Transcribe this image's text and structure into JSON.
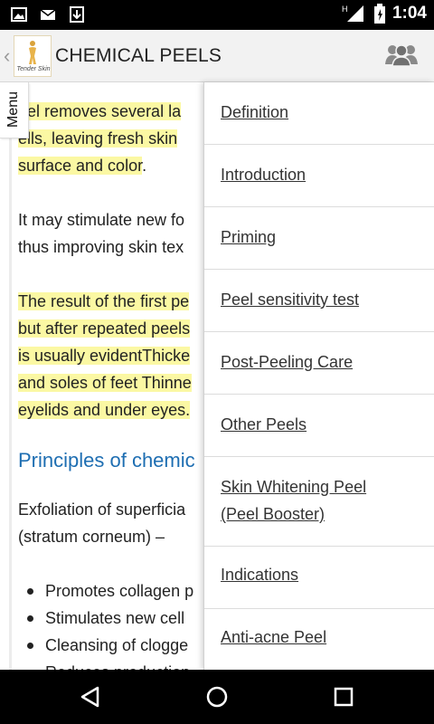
{
  "status_bar": {
    "time": "1:04",
    "icons": [
      "image-icon",
      "mail-icon",
      "download-icon",
      "signal-icon",
      "battery-icon"
    ]
  },
  "app_bar": {
    "back_glyph": "‹",
    "logo_text": "Tender Skin",
    "title": "CHEMICAL PEELS",
    "action_icon": "group-icon"
  },
  "menu_tab": {
    "label": "Menu"
  },
  "content": {
    "para1": [
      "eel removes several la",
      "ells, leaving fresh skin",
      "surface and color",
      "."
    ],
    "para2": [
      "It may stimulate new fo",
      "thus improving skin tex"
    ],
    "para3": [
      "The result of the first pe",
      "but after repeated peels",
      "is usually evidentThicke",
      "and soles of feet Thinne",
      "eyelids and under eyes."
    ],
    "heading": "Principles of chemic",
    "para4": [
      "Exfoliation of superficia",
      "(stratum corneum) –"
    ],
    "bullets": [
      "Promotes collagen p",
      "Stimulates new cell",
      "Cleansing of clogge",
      "Reduces production"
    ]
  },
  "drawer": {
    "items": [
      "Definition",
      "Introduction",
      "Priming",
      "Peel sensitivity test",
      "Post-Peeling Care",
      "Other Peels",
      "Skin Whitening Peel (Peel Booster)",
      "Indications",
      "Anti-acne Peel"
    ],
    "skin_whitening_lines": [
      "Skin Whitening Peel",
      "(Peel Booster)"
    ]
  },
  "nav_bar": {
    "icons": [
      "back-icon",
      "home-icon",
      "recents-icon"
    ]
  },
  "colors": {
    "highlight": "#fbf8a3",
    "heading": "#1e6eb2",
    "statusbar": "#000000"
  }
}
